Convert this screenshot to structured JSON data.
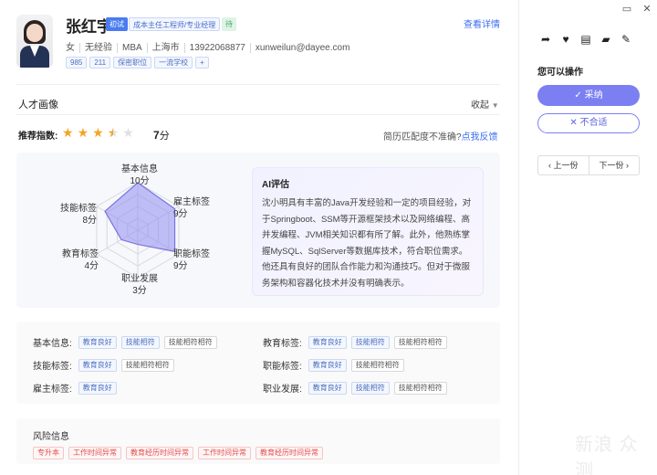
{
  "candidate": {
    "name": "张红宇",
    "badge_new": "初试",
    "job_title": "成本主任工程师/专业经理",
    "badge_green": "待",
    "gender": "女",
    "experience": "无经验",
    "degree": "MBA",
    "city": "上海市",
    "phone": "13922068877",
    "email": "xunweilun@dayee.com",
    "chips": [
      "985",
      "211",
      "保密职位",
      "一流学校",
      "+"
    ]
  },
  "header": {
    "view_detail": "查看详情"
  },
  "profile": {
    "section_title": "人才画像",
    "collapse_label": "收起",
    "rec_label": "推荐指数:",
    "rating": 3.5,
    "score_value": "7",
    "score_unit": "分",
    "match_question": "简历匹配度不准确?",
    "feedback_link": "点我反馈"
  },
  "chart_data": {
    "type": "radar",
    "max": 10,
    "axes": [
      {
        "name": "基本信息",
        "label": "10分",
        "value": 10
      },
      {
        "name": "雇主标签",
        "label": "9分",
        "value": 9
      },
      {
        "name": "职能标签",
        "label": "9分",
        "value": 9
      },
      {
        "name": "职业发展",
        "label": "3分",
        "value": 3
      },
      {
        "name": "教育标签",
        "label": "4分",
        "value": 4
      },
      {
        "name": "技能标签",
        "label": "8分",
        "value": 8
      }
    ]
  },
  "ai": {
    "title": "AI评估",
    "text": "沈小明具有丰富的Java开发经验和一定的项目经验，对于Springboot、SSM等开源框架技术以及网络编程、高并发编程、JVM相关知识都有所了解。此外，他熟练掌握MySQL、SqlServer等数据库技术，符合职位需求。他还具有良好的团队合作能力和沟通技巧。但对于微服务架构和容器化技术并没有明确表示。"
  },
  "tag_groups": {
    "basic": {
      "label": "基本信息:",
      "tags": [
        "教育良好",
        "技能相符",
        "技能相符相符"
      ]
    },
    "edu": {
      "label": "教育标签:",
      "tags": [
        "教育良好",
        "技能相符",
        "技能相符相符"
      ]
    },
    "skill": {
      "label": "技能标签:",
      "tags": [
        "教育良好",
        "技能相符相符"
      ]
    },
    "func": {
      "label": "职能标签:",
      "tags": [
        "教育良好",
        "技能相符相符"
      ]
    },
    "employer": {
      "label": "雇主标签:",
      "tags": [
        "教育良好"
      ]
    },
    "career": {
      "label": "职业发展:",
      "tags": [
        "教育良好",
        "技能相符",
        "技能相符相符"
      ]
    }
  },
  "risk": {
    "title": "风险信息",
    "tags": [
      "专升本",
      "工作时间异常",
      "教育经历时间异常",
      "工作时间异常",
      "教育经历时间异常"
    ]
  },
  "side": {
    "ops_title": "您可以操作",
    "accept_label": "采纳",
    "reject_label": "不合适",
    "prev_label": "上一份",
    "next_label": "下一份"
  },
  "watermark": "新浪 众测",
  "colors": {
    "accent": "#7c7ff2",
    "link": "#3d6ef2",
    "star": "#f3a623",
    "risk": "#e0504e"
  }
}
